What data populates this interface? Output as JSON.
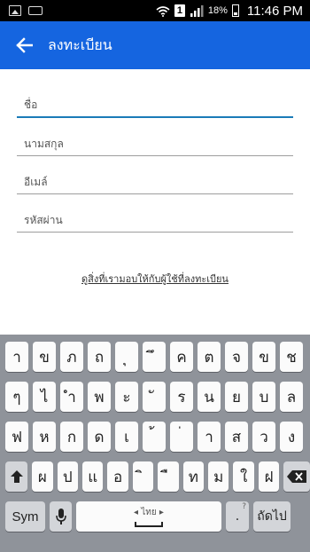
{
  "status_bar": {
    "sim_badge": "1",
    "battery_percent": "18%",
    "time": "11:46 PM"
  },
  "app_bar": {
    "title": "ลงทะเบียน",
    "back_icon": "arrow-left-icon"
  },
  "form": {
    "name_placeholder": "ชื่อ",
    "lastname_placeholder": "นามสกุล",
    "email_placeholder": "อีเมล์",
    "password_placeholder": "รหัสผ่าน",
    "terms_link": "ดูสิ่งที่เรามอบให้กับผู้ใช้ที่ลงทะเบียน"
  },
  "keyboard": {
    "row1": [
      "า",
      "ข",
      "ภ",
      "ถ",
      "ุ",
      "ึ",
      "ค",
      "ต",
      "จ",
      "ข",
      "ช"
    ],
    "row2": [
      "ๆ",
      "ไ",
      "ำ",
      "พ",
      "ะ",
      "ั",
      "ร",
      "น",
      "ย",
      "บ",
      "ล"
    ],
    "row3": [
      "ฟ",
      "ห",
      "ก",
      "ด",
      "เ",
      "้",
      "่",
      "า",
      "ส",
      "ว",
      "ง"
    ],
    "row4": [
      "ผ",
      "ป",
      "แ",
      "อ",
      "ิ",
      "ื",
      "ท",
      "ม",
      "ใ",
      "ฝ"
    ],
    "sym_label": "Sym",
    "space_lang": "ไทย",
    "punct_label": ".",
    "punct_hint": "?",
    "enter_label": "ถัดไป",
    "accent_color": "#1565e0"
  }
}
